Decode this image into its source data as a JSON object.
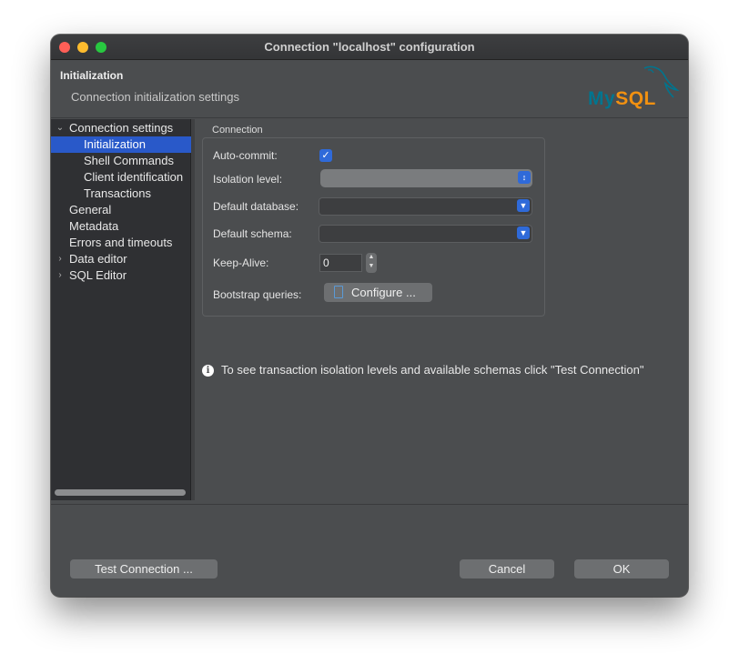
{
  "window": {
    "title": "Connection \"localhost\" configuration"
  },
  "header": {
    "title": "Initialization",
    "subtitle": "Connection initialization settings",
    "logo_my": "My",
    "logo_sql": "SQL"
  },
  "sidebar": {
    "items": [
      {
        "label": "Connection settings",
        "expanded": true
      },
      {
        "label": "Initialization",
        "selected": true
      },
      {
        "label": "Shell Commands"
      },
      {
        "label": "Client identification"
      },
      {
        "label": "Transactions"
      },
      {
        "label": "General"
      },
      {
        "label": "Metadata"
      },
      {
        "label": "Errors and timeouts"
      },
      {
        "label": "Data editor",
        "expandable": true
      },
      {
        "label": "SQL Editor",
        "expandable": true
      }
    ]
  },
  "connection": {
    "group_title": "Connection",
    "autocommit_label": "Auto-commit:",
    "autocommit_checked": true,
    "isolation_label": "Isolation level:",
    "isolation_value": "",
    "default_db_label": "Default database:",
    "default_db_value": "",
    "default_schema_label": "Default schema:",
    "default_schema_value": "",
    "keepalive_label": "Keep-Alive:",
    "keepalive_value": "0",
    "bootstrap_label": "Bootstrap queries:",
    "configure_label": "Configure ..."
  },
  "info": {
    "text": "To see transaction isolation levels and available schemas click \"Test Connection\""
  },
  "buttons": {
    "test_connection": "Test Connection ...",
    "cancel": "Cancel",
    "ok": "OK"
  },
  "colors": {
    "accent": "#2f6ad9",
    "selection": "#2959c9",
    "mysql_blue": "#00758f",
    "mysql_orange": "#f29111"
  }
}
